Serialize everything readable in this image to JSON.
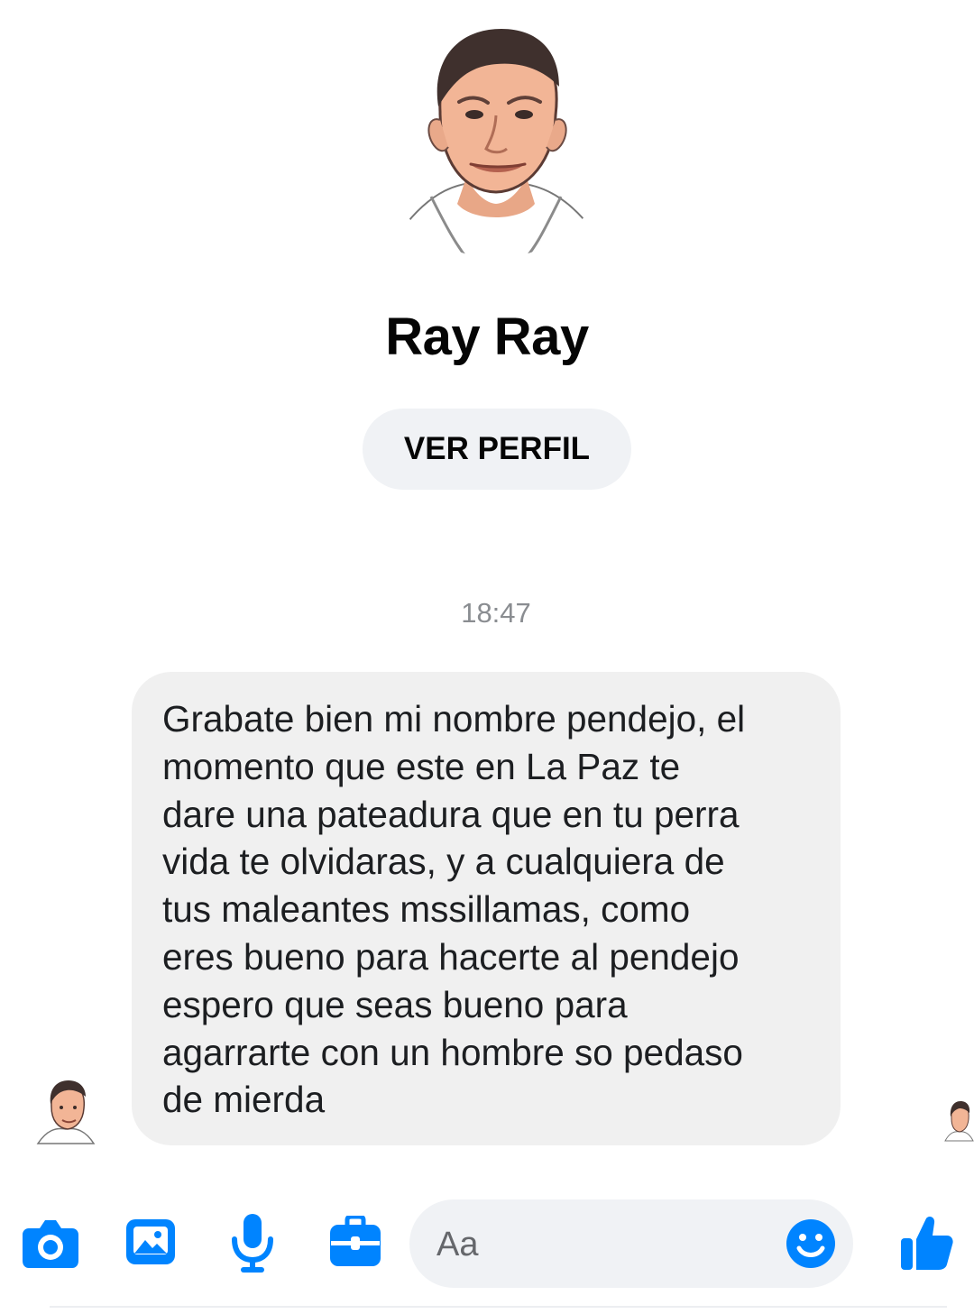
{
  "profile": {
    "name": "Ray Ray",
    "view_profile_label": "VER PERFIL"
  },
  "conversation": {
    "timestamp": "18:47",
    "messages": [
      {
        "sender": "Ray Ray",
        "text": "Grabate bien mi nombre pendejo, el\nmomento que este en La Paz te\ndare una pateadura que en tu perra\nvida te olvidaras, y a cualquiera de\ntus maleantes mssillamas, como\neres bueno para hacerte al pendejo\nespero que seas bueno para\nagarrarte con un hombre so pedaso\nde mierda"
      }
    ]
  },
  "composer": {
    "placeholder": "Aa",
    "icons": [
      "camera-icon",
      "gallery-icon",
      "microphone-icon",
      "toolbox-icon",
      "emoji-icon",
      "thumbs-up-icon"
    ]
  },
  "colors": {
    "accent": "#0084ff",
    "bubble": "#f0f0f0",
    "button": "#f0f2f5",
    "muted_text": "#8a8d91"
  }
}
